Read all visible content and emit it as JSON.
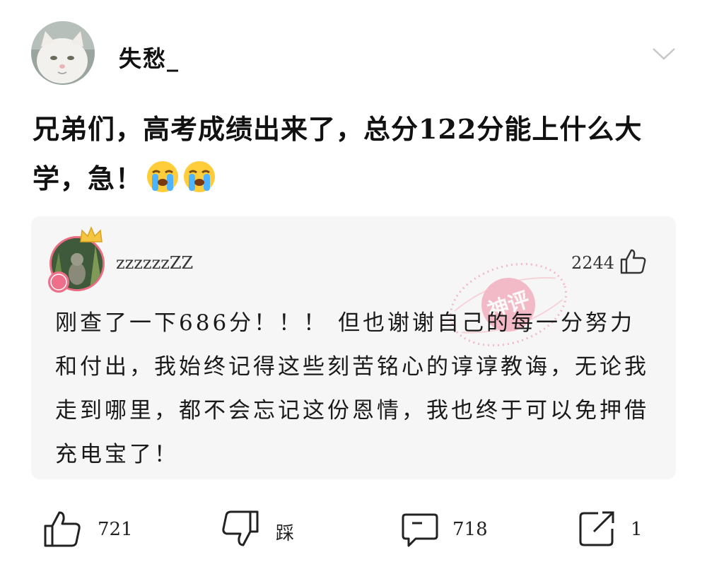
{
  "post": {
    "author": "失愁_",
    "title": "兄弟们，高考成绩出来了，总分122分能上什么大学，急！",
    "emoji_name": "crying-face"
  },
  "comment": {
    "author": "zzzzzzZZ",
    "likes": "2244",
    "stamp_text": "神评",
    "text": "刚查了一下686分！！！ 但也谢谢自己的每一分努力和付出，我始终记得这些刻苦铭心的谆谆教诲，无论我走到哪里，都不会忘记这份恩情，我也终于可以免押借充电宝了！"
  },
  "actions": {
    "like_count": "721",
    "dislike_label": "踩",
    "comment_count": "718",
    "share_count": "1"
  },
  "colors": {
    "stamp_pink": "#f08aa0",
    "avatar_border": "#e96c82",
    "card_bg": "#f6f6f6"
  }
}
